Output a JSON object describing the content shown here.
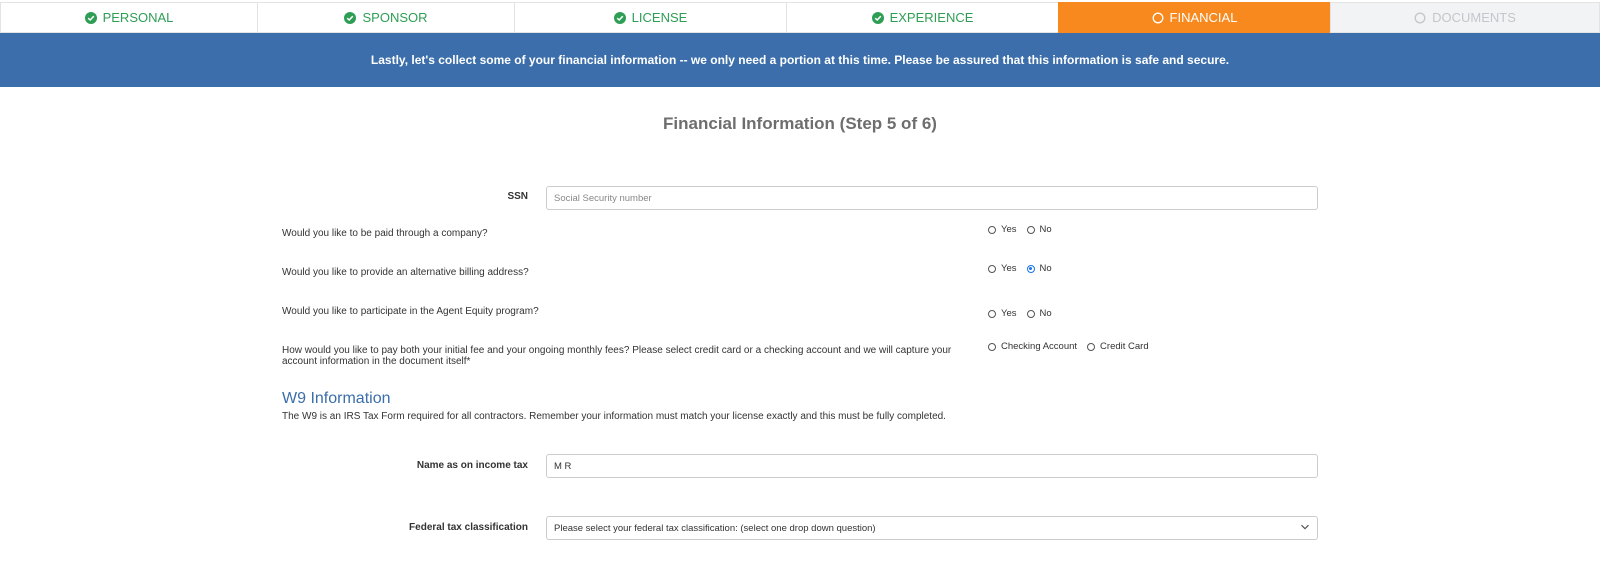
{
  "steps": [
    {
      "label": "PERSONAL",
      "state": "complete"
    },
    {
      "label": "SPONSOR",
      "state": "complete"
    },
    {
      "label": "LICENSE",
      "state": "complete"
    },
    {
      "label": "EXPERIENCE",
      "state": "complete"
    },
    {
      "label": "FINANCIAL",
      "state": "active"
    },
    {
      "label": "DOCUMENTS",
      "state": "disabled"
    }
  ],
  "banner": "Lastly, let's collect some of your financial information -- we only need a portion at this time. Please be assured that this information is safe and secure.",
  "page_title": "Financial Information (Step 5 of 6)",
  "ssn": {
    "label": "SSN",
    "value": "",
    "placeholder": "Social Security number"
  },
  "questions": {
    "company": {
      "text": "Would you like to be paid through a company?",
      "yes": "Yes",
      "no": "No",
      "selected": null
    },
    "billing": {
      "text": "Would you like to provide an alternative billing address?",
      "yes": "Yes",
      "no": "No",
      "selected": "No"
    },
    "equity": {
      "text": "Would you like to participate in the Agent Equity program?",
      "yes": "Yes",
      "no": "No",
      "selected": null
    },
    "payment": {
      "text": "How would you like to pay both your initial fee and your ongoing monthly fees? Please select credit card or a checking account and we will capture your account information in the document itself*",
      "opt1": "Checking Account",
      "opt2": "Credit Card",
      "selected": null
    }
  },
  "w9": {
    "title": "W9 Information",
    "description": "The W9 is an IRS Tax Form required for all contractors. Remember your information must match your license exactly and this must be fully completed.",
    "name_label": "Name as on income tax",
    "name_value": "M R",
    "classification_label": "Federal tax classification",
    "classification_value": "Please select your federal tax classification: (select one drop down question)"
  },
  "colors": {
    "complete": "#2e9e55",
    "active": "#f7891e",
    "banner": "#3b6eaa",
    "disabled": "#c3c7cb"
  }
}
